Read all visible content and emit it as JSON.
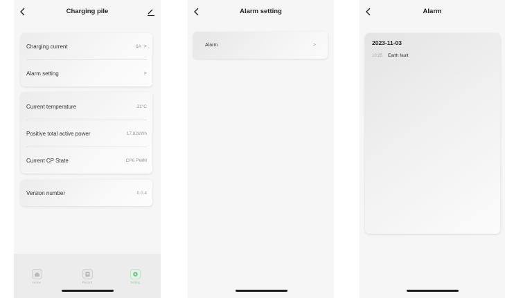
{
  "screen1": {
    "title": "Charging pile",
    "group1": [
      {
        "label": "Charging current",
        "value": "6A"
      },
      {
        "label": "Alarm setting",
        "value": ""
      }
    ],
    "group2": [
      {
        "label": "Current temperature",
        "value": "31°C"
      },
      {
        "label": "Positive total active power",
        "value": "17.82kWh"
      },
      {
        "label": "Current CP State",
        "value": "CP6 PWM"
      }
    ],
    "group3": [
      {
        "label": "Version number",
        "value": "0.0.4"
      }
    ],
    "tabs": [
      {
        "label": "Home",
        "icon": "home-icon",
        "active": false
      },
      {
        "label": "Record",
        "icon": "record-icon",
        "active": false
      },
      {
        "label": "Setting",
        "icon": "settings-icon",
        "active": true
      }
    ],
    "accent": "#8bd39c"
  },
  "screen2": {
    "title": "Alarm setting",
    "item": "Alarm"
  },
  "screen3": {
    "title": "Alarm",
    "date": "2023-11-03",
    "entries": [
      {
        "time": "10:25",
        "message": "Earth fault"
      }
    ]
  }
}
